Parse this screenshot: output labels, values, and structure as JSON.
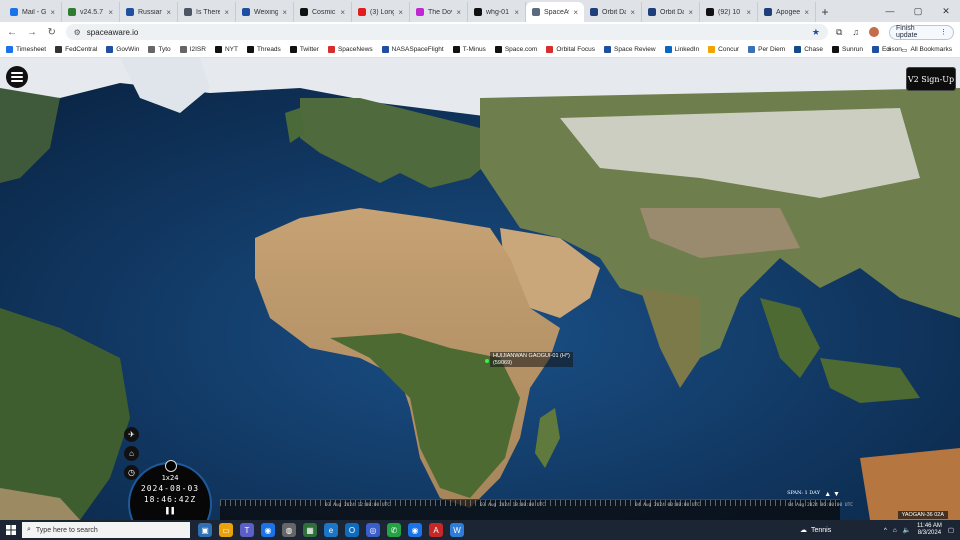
{
  "browser": {
    "tabs": [
      {
        "label": "Mail - Gi",
        "color": "#1a73e8"
      },
      {
        "label": "v24.5.7 T",
        "color": "#2e7d32"
      },
      {
        "label": "Russian",
        "color": "#1f4fa0"
      },
      {
        "label": "Is There",
        "color": "#4b5563"
      },
      {
        "label": "Weixing",
        "color": "#1f4fa0"
      },
      {
        "label": "Cosmic",
        "color": "#111111"
      },
      {
        "label": "(3) Long",
        "color": "#e11d1d"
      },
      {
        "label": "The Dov",
        "color": "#c026d3"
      },
      {
        "label": "whg-01",
        "color": "#111111"
      },
      {
        "label": "SpaceAw",
        "color": "#5a6b7d",
        "active": true
      },
      {
        "label": "Orbit Da",
        "color": "#1f3f7a"
      },
      {
        "label": "Orbit Da",
        "color": "#1f3f7a"
      },
      {
        "label": "(92) 10",
        "color": "#111111"
      },
      {
        "label": "Apogee",
        "color": "#1f3f7a"
      }
    ],
    "url": "spaceaware.io",
    "finish_update": "Finish update",
    "bookmarks": [
      {
        "label": "Timesheet",
        "color": "#1a73e8"
      },
      {
        "label": "FedCentral",
        "color": "#333333"
      },
      {
        "label": "GovWin",
        "color": "#1f4fa0"
      },
      {
        "label": "Tyto",
        "color": "#666666"
      },
      {
        "label": "I2ISR",
        "color": "#666666"
      },
      {
        "label": "NYT",
        "color": "#111111"
      },
      {
        "label": "Threads",
        "color": "#111111"
      },
      {
        "label": "Twitter",
        "color": "#111111"
      },
      {
        "label": "SpaceNews",
        "color": "#d62d2d"
      },
      {
        "label": "NASASpaceFlight",
        "color": "#1f4fa0"
      },
      {
        "label": "T-Minus",
        "color": "#111111"
      },
      {
        "label": "Space.com",
        "color": "#111111"
      },
      {
        "label": "Orbital Focus",
        "color": "#d62d2d"
      },
      {
        "label": "Space Review",
        "color": "#1f4fa0"
      },
      {
        "label": "LinkedIn",
        "color": "#0a66c2"
      },
      {
        "label": "Concur",
        "color": "#f0a500"
      },
      {
        "label": "Per Diem",
        "color": "#3b6fb6"
      },
      {
        "label": "Chase",
        "color": "#124a8a"
      },
      {
        "label": "Sunrun",
        "color": "#111111"
      },
      {
        "label": "Edison",
        "color": "#1f4fa0"
      }
    ],
    "all_bookmarks": "All Bookmarks"
  },
  "app": {
    "signup_label": "V2 Sign-Up",
    "satellite": {
      "name": "HUIJIANWAN GAOGUI-01 (H*)",
      "id": "(59069)"
    },
    "clock": {
      "speed": "1x24",
      "date": "2024-08-03",
      "time": "18:46:42Z"
    },
    "timeline": [
      "03 Aug 2024 12:00:00 UTC",
      "03 Aug 2024 18:00:00 UTC",
      "04 Aug 2024 00:00:00 UTC",
      "04 Aug 2024 06:00:00 UTC"
    ],
    "span": "SPAN: 1 DAY",
    "corner_label": "YAOGAN-36 02A"
  },
  "taskbar": {
    "search_placeholder": "Type here to search",
    "weather": "Tennis",
    "time": "11:46 AM",
    "date": "8/3/2024"
  }
}
